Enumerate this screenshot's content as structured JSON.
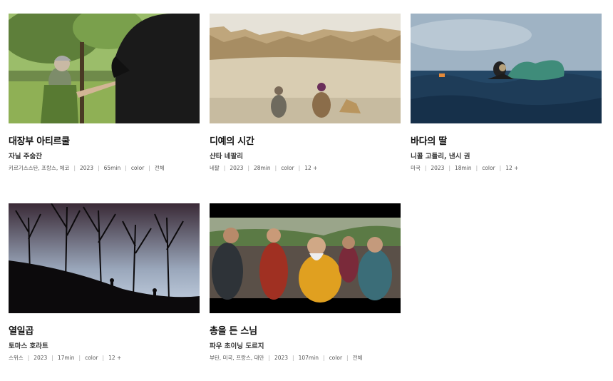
{
  "films": [
    {
      "title": "대장부 아티르쿨",
      "director": "자닐 주숨잔",
      "meta": [
        "키르기스스탄, 프랑스, 체코",
        "2023",
        "65min",
        "color",
        "전체"
      ],
      "image": "woman-with-horse-in-orchard"
    },
    {
      "title": "디예의 시간",
      "director": "샨타 네팔리",
      "meta": [
        "네팔",
        "2023",
        "28min",
        "color",
        "12 +"
      ],
      "image": "women-in-desert-canyon"
    },
    {
      "title": "바다의 딸",
      "director": "니콜 고들리, 낸시 권",
      "meta": [
        "미국",
        "2023",
        "18min",
        "color",
        "12 +"
      ],
      "image": "diver-in-sea-with-net"
    },
    {
      "title": "열일곱",
      "director": "토마스 호라트",
      "meta": [
        "스위스",
        "2023",
        "17min",
        "color",
        "12 +"
      ],
      "image": "silhouette-trees-on-hill"
    },
    {
      "title": "총을 든 스님",
      "director": "파우 초이닝 도르지",
      "meta": [
        "부탄, 미국, 프랑스, 대만",
        "2023",
        "107min",
        "color",
        "전체"
      ],
      "image": "monk-and-crowd"
    }
  ]
}
